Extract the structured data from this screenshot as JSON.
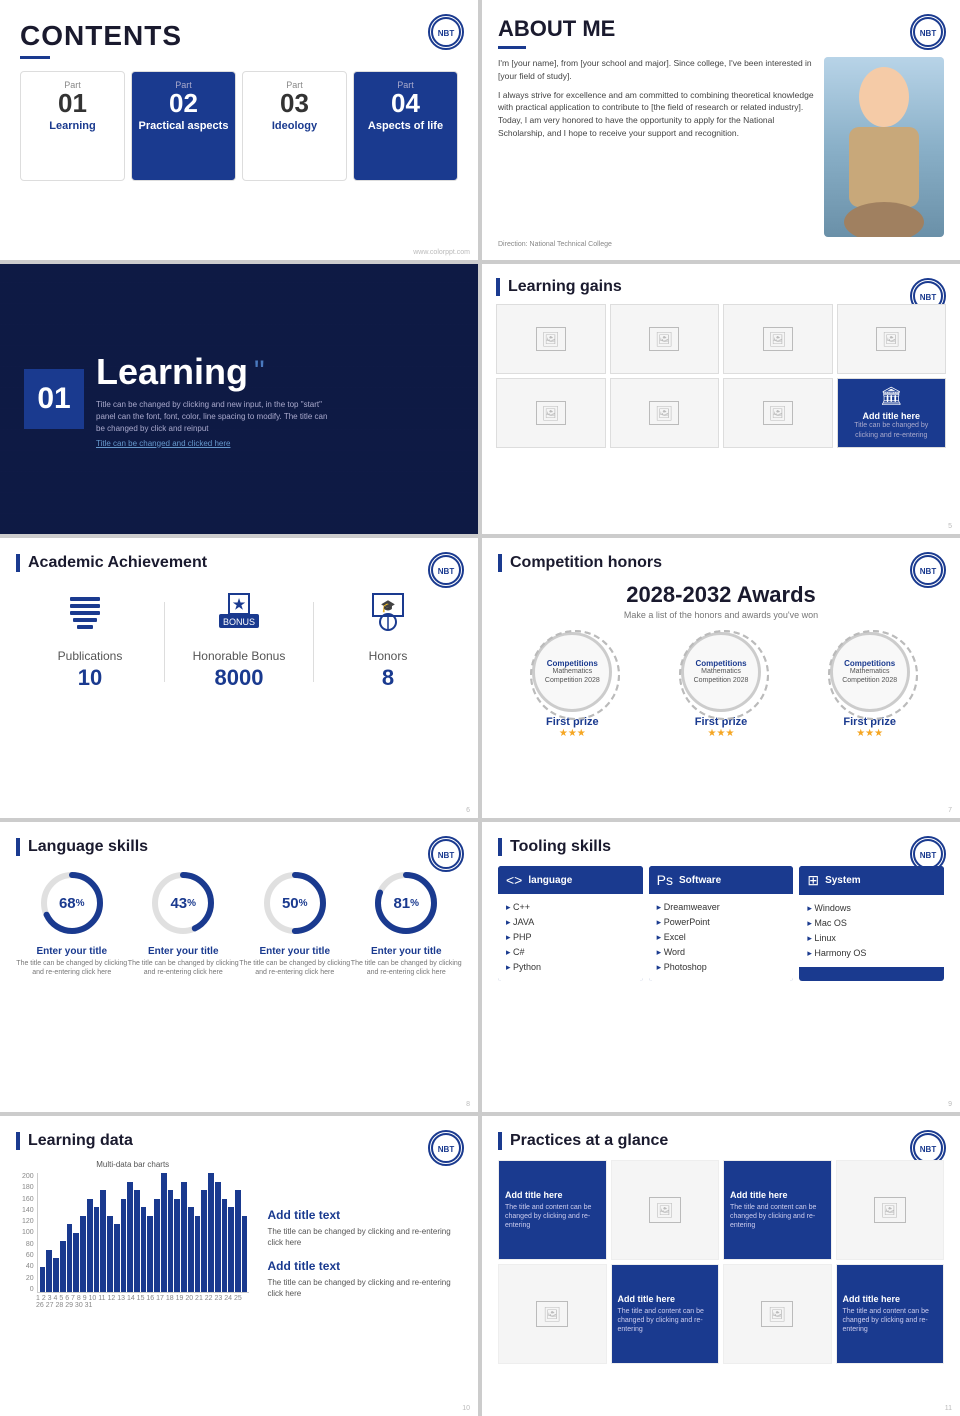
{
  "slide1": {
    "title": "CONTENTS",
    "parts": [
      {
        "label": "Part",
        "num": "01",
        "name": "Learning",
        "active": false
      },
      {
        "label": "Part",
        "num": "02",
        "name": "Practical aspects",
        "active": true
      },
      {
        "label": "Part",
        "num": "03",
        "name": "Ideology",
        "active": false
      },
      {
        "label": "Part",
        "num": "04",
        "name": "Aspects of life",
        "active": true
      }
    ]
  },
  "slide2": {
    "title": "ABOUT ME",
    "paragraphs": [
      "I'm [your name], from [your school and major]. Since college, I've been interested in [your field of study].",
      "I always strive for excellence and am committed to combining theoretical knowledge with practical application to contribute to [the field of research or related industry]. Today, I am very honored to have the opportunity to apply for the National Scholarship, and I hope to receive your support and recognition."
    ],
    "footer": "Direction: National Technical College"
  },
  "slide3": {
    "num": "01",
    "title": "Learning",
    "subtitle": "Title can be changed by clicking and new input, in the top \"start\" panel can the font, font, color, line spacing to modify. The title can be changed by click and reinput",
    "link": "Title can be changed and clicked here"
  },
  "slide4": {
    "title": "Learning gains",
    "featured_title": "Add title here",
    "featured_sub": "Title can be changed by clicking and re-entering"
  },
  "slide5": {
    "title": "Academic Achievement",
    "stats": [
      {
        "icon": "📚",
        "label": "Publications",
        "value": "10"
      },
      {
        "icon": "🏅",
        "label": "Honorable Bonus",
        "value": "8000"
      },
      {
        "icon": "🎓",
        "label": "Honors",
        "value": "8"
      }
    ]
  },
  "slide6": {
    "title": "Competition honors",
    "year_range": "2028-2032 Awards",
    "subtitle": "Make a list of the honors and awards you've won",
    "awards": [
      {
        "comp": "Competitions",
        "name": "Mathematics Competition 2028",
        "prize": "First prize"
      },
      {
        "comp": "Competitions",
        "name": "Mathematics Competition 2028",
        "prize": "First prize"
      },
      {
        "comp": "Competitions",
        "name": "Mathematics Competition 2028",
        "prize": "First prize"
      }
    ]
  },
  "slide7": {
    "title": "Language skills",
    "skills": [
      {
        "pct": 68,
        "label": "Enter your title",
        "desc": "The title can be changed by clicking and re-entering click here"
      },
      {
        "pct": 43,
        "label": "Enter your title",
        "desc": "The title can be changed by clicking and re-entering click here"
      },
      {
        "pct": 50,
        "label": "Enter your title",
        "desc": "The title can be changed by clicking and re-entering click here"
      },
      {
        "pct": 81,
        "label": "Enter your title",
        "desc": "The title can be changed by clicking and re-entering click here"
      }
    ]
  },
  "slide8": {
    "title": "Tooling skills",
    "columns": [
      {
        "icon": "<>",
        "header": "language",
        "items": [
          "C++",
          "JAVA",
          "PHP",
          "C#",
          "Python"
        ]
      },
      {
        "icon": "Ps",
        "header": "Software",
        "items": [
          "Dreamweaver",
          "PowerPoint",
          "Excel",
          "Word",
          "Photoshop"
        ]
      },
      {
        "icon": "⊞",
        "header": "System",
        "items": [
          "Windows",
          "Mac OS",
          "Linux",
          "Harmony OS"
        ]
      }
    ]
  },
  "slide9": {
    "title": "Learning data",
    "chart_title": "Multi-data bar charts",
    "text_items": [
      {
        "label": "Add title text",
        "desc": "The title can be changed by clicking and re-entering click here"
      },
      {
        "label": "Add title text",
        "desc": "The title can be changed by clicking and re-entering click here"
      }
    ],
    "bars": [
      3,
      5,
      4,
      6,
      8,
      7,
      9,
      11,
      10,
      12,
      9,
      8,
      11,
      13,
      12,
      10,
      9,
      11,
      14,
      12,
      11,
      13,
      10,
      9,
      12,
      14,
      13,
      11,
      10,
      12,
      9
    ]
  },
  "slide10": {
    "title": "Practices at a glance",
    "cells": [
      {
        "type": "blue",
        "title": "Add title here",
        "desc": "The title and content can be changed by clicking and re-entering"
      },
      {
        "type": "img"
      },
      {
        "type": "blue",
        "title": "Add title here",
        "desc": "The title and content can be changed by clicking and re-entering"
      },
      {
        "type": "img"
      },
      {
        "type": "blue",
        "title": "Add title here",
        "desc": "The title and content can be changed by clicking and re-entering"
      },
      {
        "type": "img"
      },
      {
        "type": "blue",
        "title": "Add title here",
        "desc": "The title and content can be changed by clicking and re-entering"
      },
      {
        "type": "img"
      }
    ]
  }
}
